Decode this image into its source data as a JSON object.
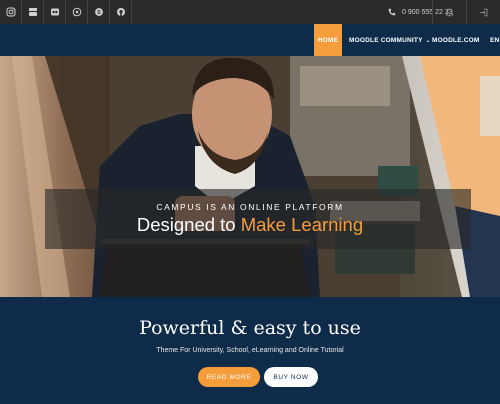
{
  "topbar": {
    "social_icons": [
      "instagram-icon",
      "youtube-icon",
      "flickr-icon",
      "whatsapp-icon",
      "skype-icon",
      "github-icon"
    ],
    "phone": "0 900 555 22 33",
    "right_icons": [
      "bell-icon",
      "login-icon"
    ]
  },
  "nav": {
    "home": "HOME",
    "community": "MOODLE COMMUNITY",
    "moodle": "MOODLE.COM",
    "lang": "EN"
  },
  "hero": {
    "tagline": "CAMPUS IS AN ONLINE PLATFORM",
    "headline_prefix": "Designed to",
    "headline_accent": "Make Learning"
  },
  "section": {
    "title": "Powerful & easy to use",
    "subtitle": "Theme For University, School, eLearning and Online Tutorial",
    "read_more": "READ MORE",
    "buy_now": "BUY NOW"
  },
  "colors": {
    "accent": "#f59d3b",
    "navy": "#0f2b4a",
    "topbar": "#2b2b2b"
  }
}
